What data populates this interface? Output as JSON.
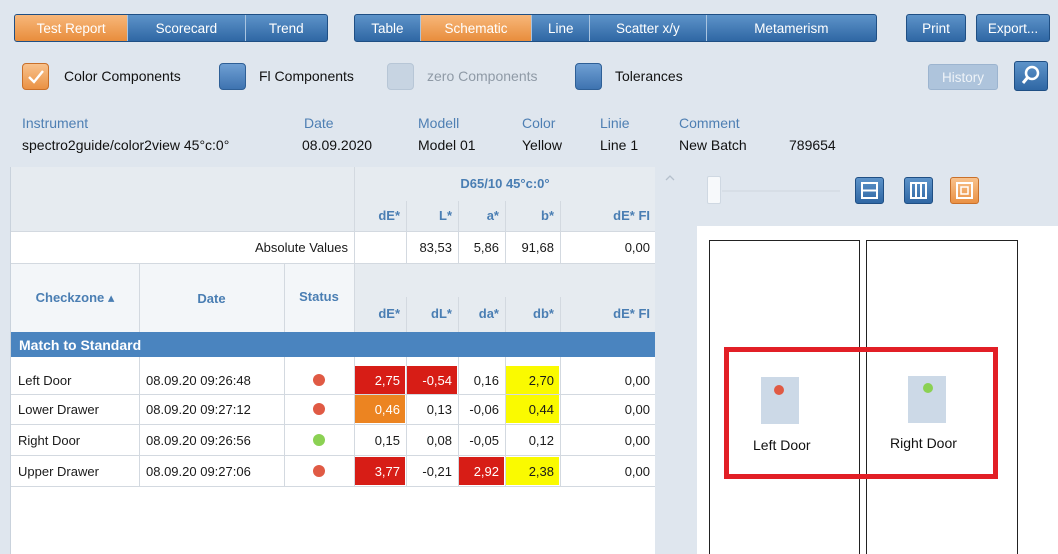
{
  "toolbar": {
    "group1": [
      {
        "label": "Test Report",
        "active": true
      },
      {
        "label": "Scorecard",
        "active": false
      },
      {
        "label": "Trend",
        "active": false
      }
    ],
    "group2": [
      {
        "label": "Table",
        "active": false
      },
      {
        "label": "Schematic",
        "active": true
      },
      {
        "label": "Line",
        "active": false
      },
      {
        "label": "Scatter x/y",
        "active": false
      },
      {
        "label": "Metamerism",
        "active": false
      }
    ],
    "print_label": "Print",
    "export_label": "Export..."
  },
  "options": {
    "color_components": {
      "label": "Color Components",
      "checked": true
    },
    "fl_components": {
      "label": "Fl Components",
      "checked": false
    },
    "zero_components": {
      "label": "zero Components",
      "enabled": false
    },
    "tolerances": {
      "label": "Tolerances",
      "checked": false
    },
    "history_label": "History",
    "search_icon": "search-icon"
  },
  "info": {
    "instrument_label": "Instrument",
    "instrument_value": "spectro2guide/color2view 45°c:0°",
    "date_label": "Date",
    "date_value": "08.09.2020",
    "modell_label": "Modell",
    "modell_value": "Model 01",
    "color_label": "Color",
    "color_value": "Yellow",
    "linie_label": "Linie",
    "linie_value": "Line 1",
    "comment_label": "Comment",
    "comment_value": "New Batch",
    "comment_extra": "789654"
  },
  "table": {
    "illuminant": "D65/10  45°c:0°",
    "abs_columns": [
      "dE*",
      "L*",
      "a*",
      "b*",
      "dE* FI"
    ],
    "abs_label": "Absolute Values",
    "abs_values": [
      "",
      "83,53",
      "5,86",
      "91,68",
      "0,00"
    ],
    "col_checkzone": "Checkzone ▴",
    "col_date": "Date",
    "col_status": "Status",
    "diff_columns": [
      "dE*",
      "dL*",
      "da*",
      "db*",
      "dE* FI"
    ],
    "section_title": "Match to Standard",
    "rows": [
      {
        "zone": "Left Door",
        "date": "08.09.20 09:26:48",
        "status": "red",
        "dE": "2,75",
        "dL": "-0,54",
        "da": "0,16",
        "db": "2,70",
        "dEFI": "0,00"
      },
      {
        "zone": "Lower Drawer",
        "date": "08.09.20 09:27:12",
        "status": "red",
        "dE": "0,46",
        "dL": "0,13",
        "da": "-0,06",
        "db": "0,44",
        "dEFI": "0,00"
      },
      {
        "zone": "Right Door",
        "date": "08.09.20 09:26:56",
        "status": "green",
        "dE": "0,15",
        "dL": "0,08",
        "da": "-0,05",
        "db": "0,12",
        "dEFI": "0,00"
      },
      {
        "zone": "Upper Drawer",
        "date": "08.09.20 09:27:06",
        "status": "red",
        "dE": "3,77",
        "dL": "-0,21",
        "da": "2,92",
        "db": "2,38",
        "dEFI": "0,00"
      }
    ]
  },
  "colors": {
    "red_cell": "#d71d16",
    "orange_cell": "#ec8421",
    "yellow_cell": "#fafa00",
    "status_red": "#e05a44",
    "status_green": "#8bd153",
    "accent_blue": "#4a84bf",
    "active_orange": "#ea9144"
  },
  "schematic": {
    "left_zone_label": "Left Door",
    "right_zone_label": "Right Door",
    "view_buttons": [
      "split-horizontal-icon",
      "split-vertical-icon",
      "fit-view-icon"
    ]
  }
}
